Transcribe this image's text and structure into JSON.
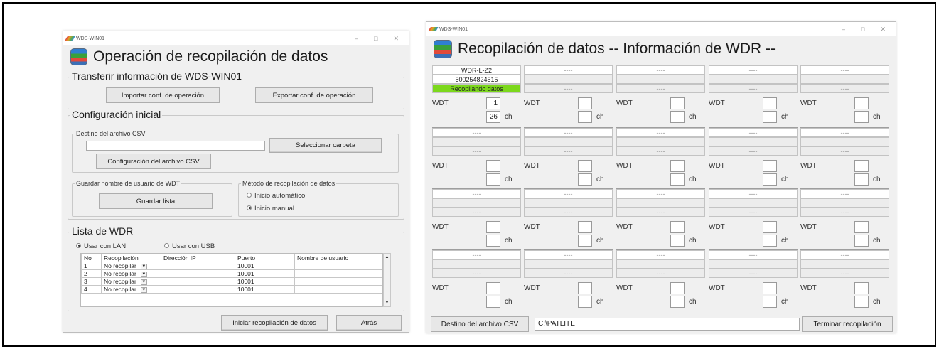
{
  "window1": {
    "title": "WDS-WIN01",
    "heading": "Operación de recopilación de datos",
    "transfer": {
      "legend": "Transferir información de WDS-WIN01",
      "import_label": "Importar conf. de operación",
      "export_label": "Exportar conf. de operación"
    },
    "initial": {
      "legend": "Configuración inicial",
      "csv_dest_legend": "Destino del archivo CSV",
      "select_folder_label": "Seleccionar carpeta",
      "csv_config_label": "Configuración del archivo CSV",
      "save_user_legend": "Guardar nombre de usuario de WDT",
      "save_list_label": "Guardar lista",
      "method_legend": "Método de recopilación de datos",
      "auto_label": "Inicio automático",
      "manual_label": "Inicio manual"
    },
    "wdr_list": {
      "legend": "Lista de WDR",
      "lan_label": "Usar con LAN",
      "usb_label": "Usar con USB",
      "columns": [
        "No",
        "Recopilación",
        "Dirección IP",
        "Puerto",
        "Nombre de usuario"
      ],
      "rows": [
        {
          "no": "1",
          "recop": "No recopilar",
          "ip": "",
          "port": "10001",
          "user": ""
        },
        {
          "no": "2",
          "recop": "No recopilar",
          "ip": "",
          "port": "10001",
          "user": ""
        },
        {
          "no": "3",
          "recop": "No recopilar",
          "ip": "",
          "port": "10001",
          "user": ""
        },
        {
          "no": "4",
          "recop": "No recopilar",
          "ip": "",
          "port": "10001",
          "user": ""
        }
      ]
    },
    "start_label": "Iniciar recopilación de datos",
    "back_label": "Atrás"
  },
  "window2": {
    "title": "WDS-WIN01",
    "heading": "Recopilación de datos -- Información de WDR --",
    "wdt_label": "WDT",
    "ch_label": "ch",
    "dash": "----",
    "first_cell": {
      "name": "WDR-L-Z2",
      "serial": "500254824515",
      "status": "Recopilando datos",
      "wdt_value": "1",
      "ch_value": "26"
    },
    "csv_dest_label": "Destino del archivo CSV",
    "path_value": "C:\\PATLITE",
    "finish_label": "Terminar recopilación"
  },
  "colors": {
    "status_green": "#7cd81c",
    "window_bg": "#f0f0f0"
  }
}
